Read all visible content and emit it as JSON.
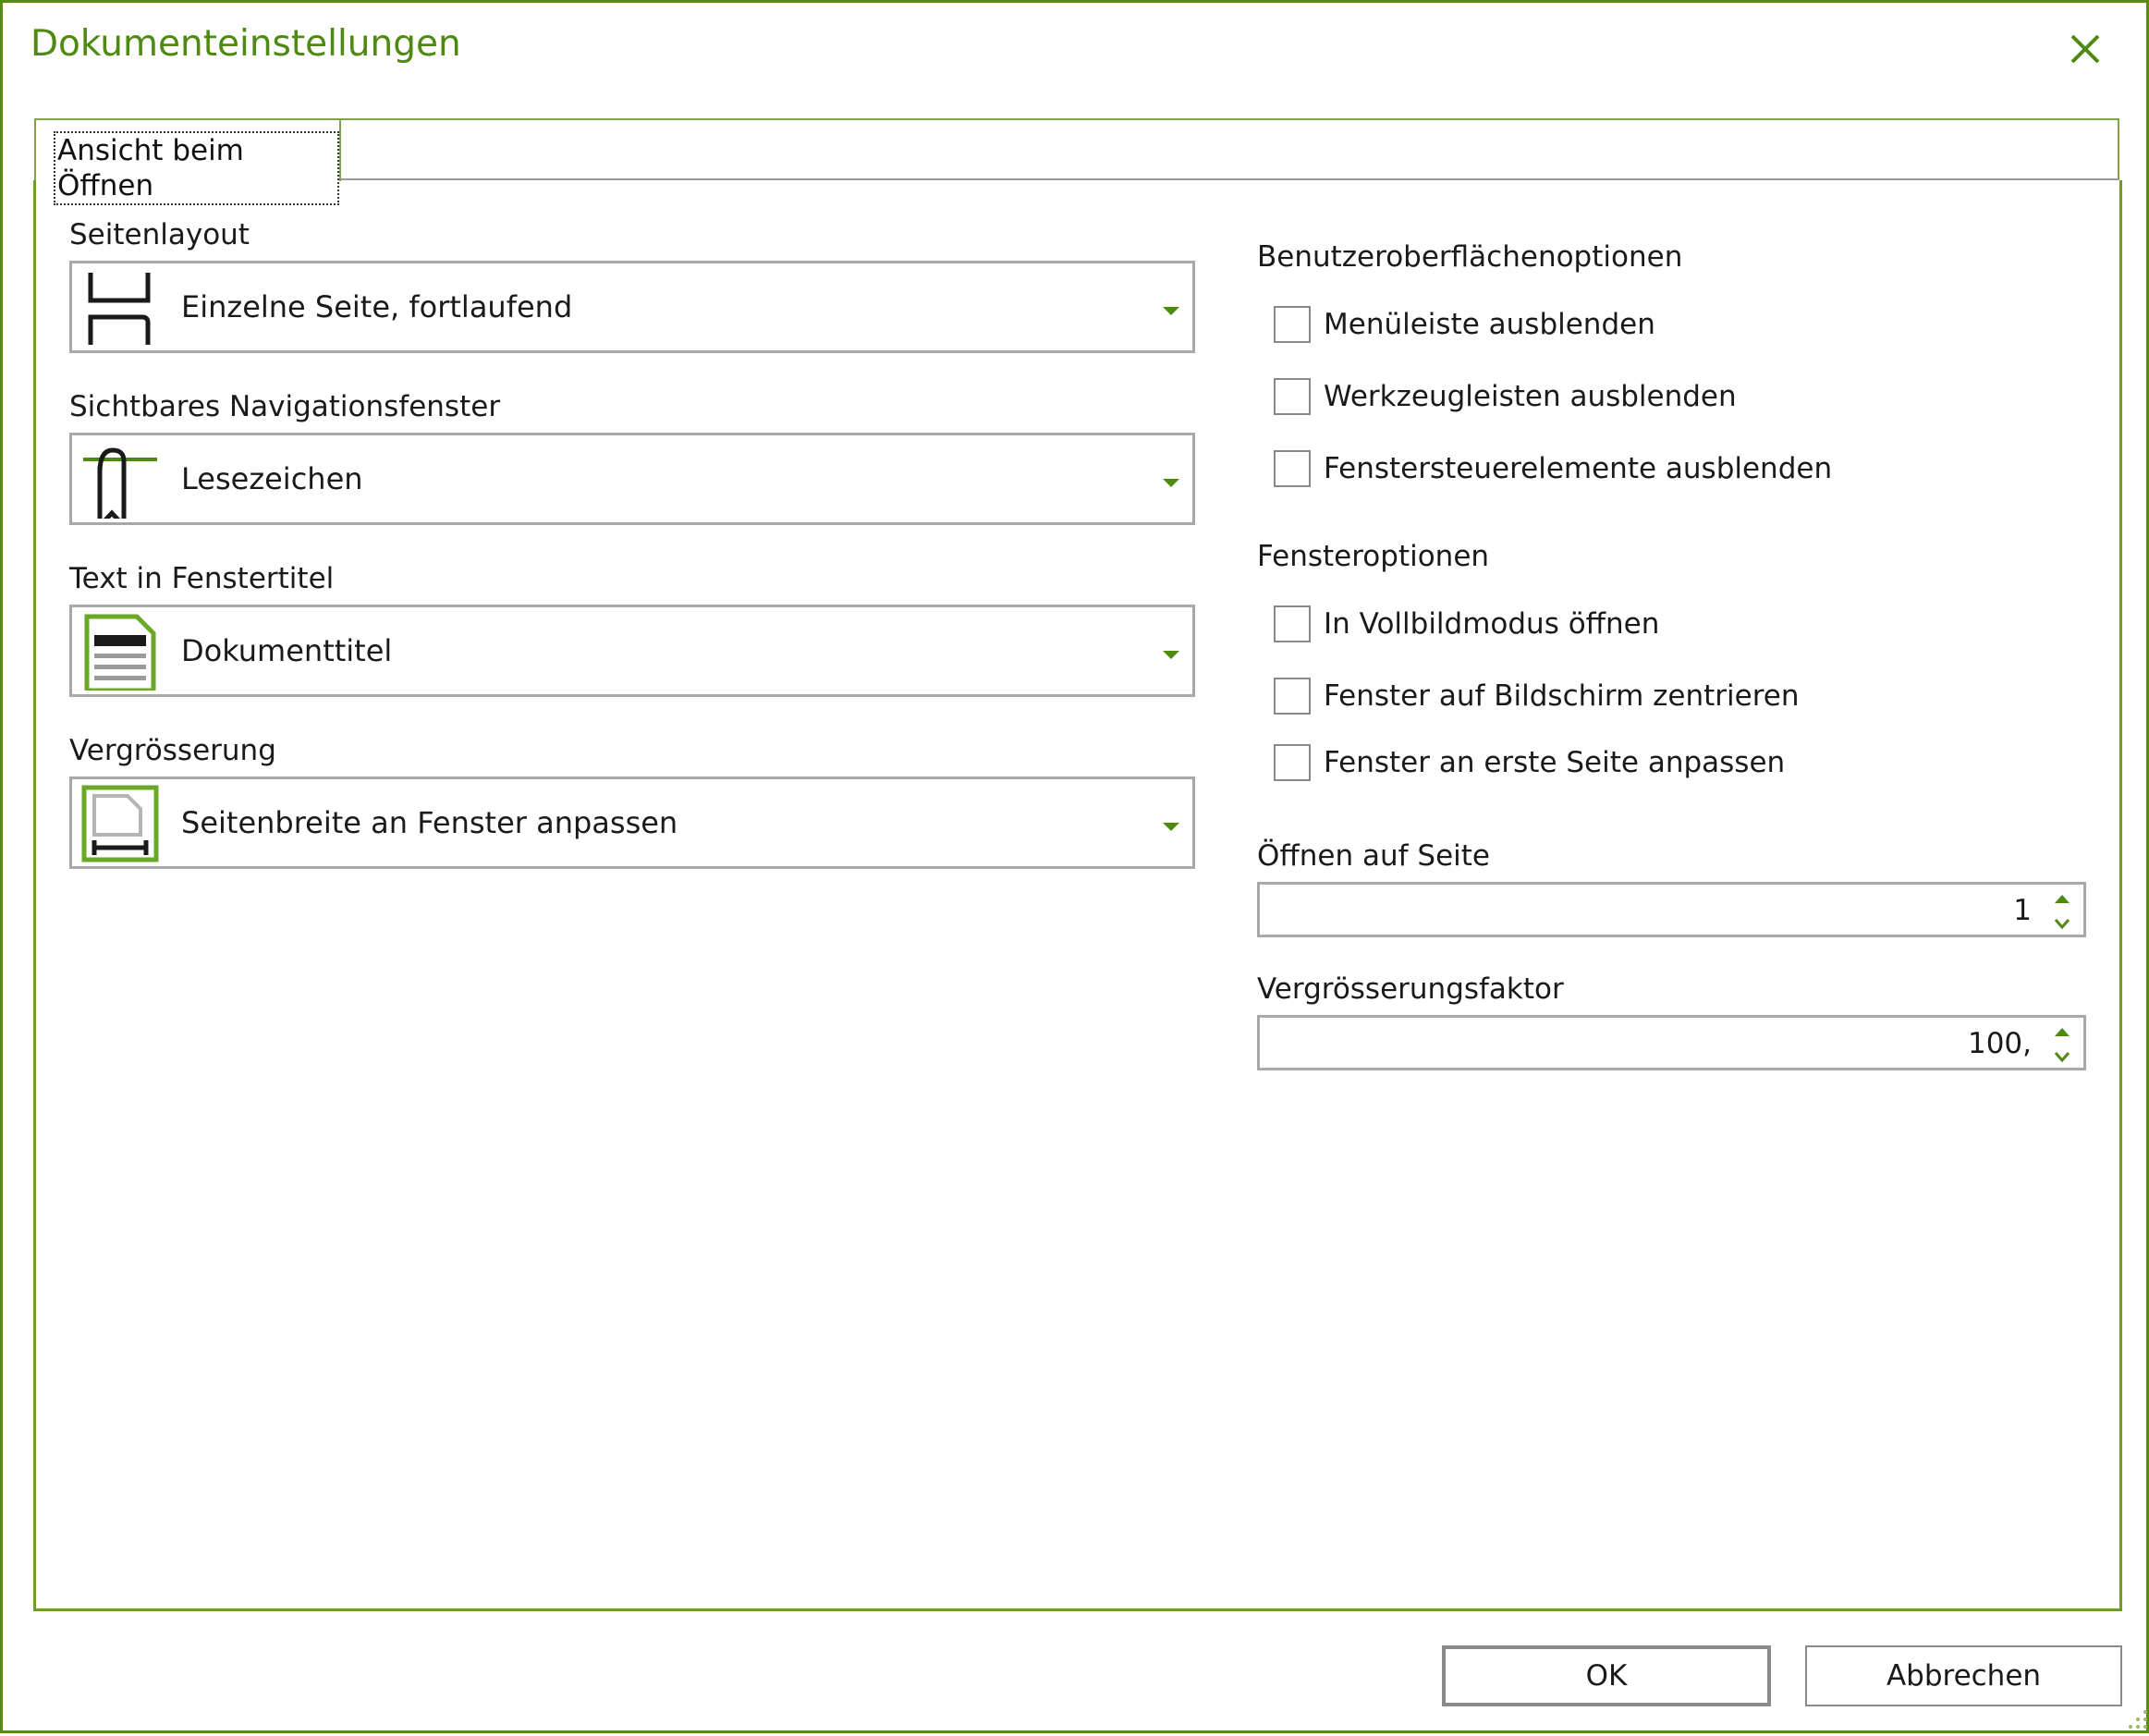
{
  "window": {
    "title": "Dokumenteinstellungen"
  },
  "tabs": [
    {
      "label": "Ansicht beim Öffnen"
    }
  ],
  "left": {
    "page_layout": {
      "label": "Seitenlayout",
      "value": "Einzelne Seite, fortlaufend",
      "icon": "page-layout-icon"
    },
    "navigation": {
      "label": "Sichtbares Navigationsfenster",
      "value": "Lesezeichen",
      "icon": "bookmark-icon"
    },
    "window_title": {
      "label": "Text in Fenstertitel",
      "value": "Dokumenttitel",
      "icon": "document-title-icon"
    },
    "zoom": {
      "label": "Vergrösserung",
      "value": "Seitenbreite an Fenster anpassen",
      "icon": "fit-width-icon"
    }
  },
  "right": {
    "ui_options": {
      "label": "Benutzeroberflächenoptionen",
      "items": [
        {
          "label": "Menüleiste ausblenden",
          "checked": false
        },
        {
          "label": "Werkzeugleisten ausblenden",
          "checked": false
        },
        {
          "label": "Fenstersteuerelemente ausblenden",
          "checked": false
        }
      ]
    },
    "window_options": {
      "label": "Fensteroptionen",
      "items": [
        {
          "label": "In Vollbildmodus öffnen",
          "checked": false
        },
        {
          "label": "Fenster auf Bildschirm zentrieren",
          "checked": false
        },
        {
          "label": "Fenster an erste Seite anpassen",
          "checked": false
        }
      ]
    },
    "open_page": {
      "label": "Öffnen auf Seite",
      "value": "1"
    },
    "zoom_factor": {
      "label": "Vergrösserungsfaktor",
      "value": "100,"
    }
  },
  "buttons": {
    "ok": "OK",
    "cancel": "Abbrechen"
  },
  "colors": {
    "accent": "#4d8a0f",
    "border": "#a8a8a8",
    "frame": "#5a8a14"
  }
}
